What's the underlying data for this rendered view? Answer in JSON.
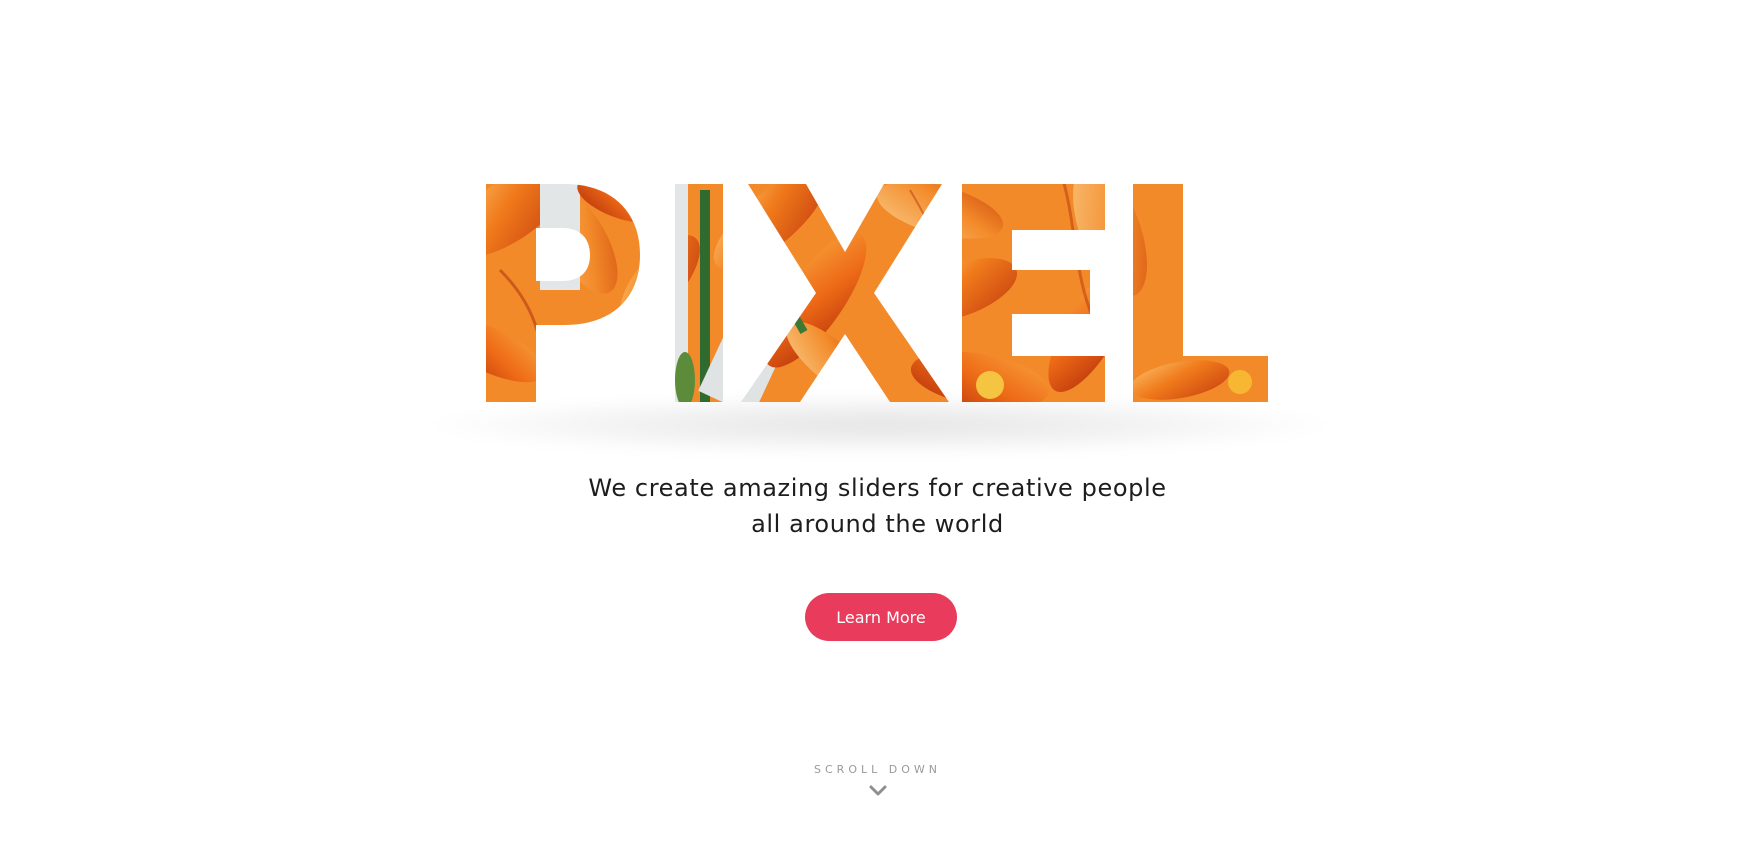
{
  "hero": {
    "word": "PIXEL",
    "subtitle_line1": "We create amazing sliders for creative people",
    "subtitle_line2": "all around the world",
    "cta_label": "Learn More"
  },
  "scroll": {
    "label": "SCROLL DOWN",
    "icon": "chevron-down-icon"
  },
  "colors": {
    "accent": "#e93b5c",
    "flower_orange": "#f07a1b",
    "flower_deep": "#d54a12",
    "flower_light": "#f8b25a",
    "stem_green": "#2f6b2f",
    "text": "#1d1d1d",
    "muted": "#9a9a9a"
  }
}
